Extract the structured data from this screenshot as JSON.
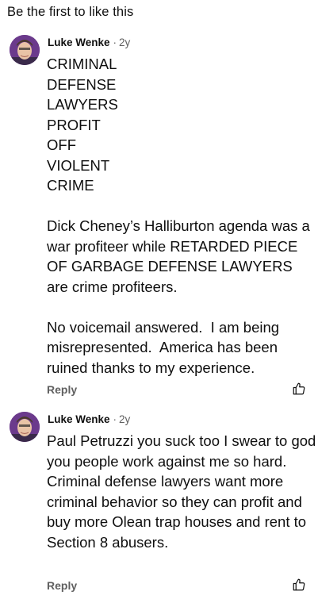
{
  "header": {
    "text": "Be the first to like this"
  },
  "comments": [
    {
      "author": "Luke Wenke",
      "separator": "·",
      "time": "2y",
      "body": "CRIMINAL\nDEFENSE\nLAWYERS\nPROFIT\nOFF\nVIOLENT\nCRIME\n\nDick Cheney’s Halliburton agenda was a war profiteer while RETARDED PIECE OF GARBAGE DEFENSE LAWYERS are crime profiteers.\n\nNo voicemail answered.  I am being misrepresented.  America has been ruined thanks to my experience.",
      "reply_label": "Reply",
      "like_icon": "thumbs-up-icon"
    },
    {
      "author": "Luke Wenke",
      "separator": "·",
      "time": "2y",
      "body": "Paul Petruzzi you suck too I swear to god you people work against me so hard.  Criminal defense lawyers want more criminal behavior so they can profit and buy more Olean trap houses and rent to Section 8 abusers.",
      "reply_label": "Reply",
      "like_icon": "thumbs-up-icon"
    }
  ],
  "colors": {
    "text_primary": "#0f0f0f",
    "text_secondary": "#606060",
    "avatar_background": "#6b3a8c"
  }
}
